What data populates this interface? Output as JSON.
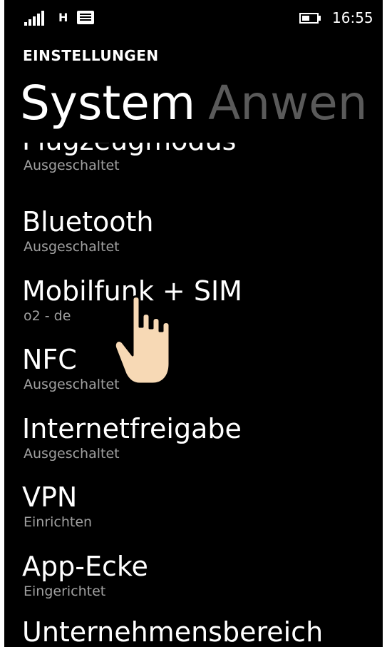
{
  "status_bar": {
    "network_type": "H",
    "time": "16:55",
    "battery_level_fraction": 0.45
  },
  "header": {
    "title": "EINSTELLUNGEN"
  },
  "pivot": {
    "active": "System",
    "next": "Anwen"
  },
  "settings": {
    "items": [
      {
        "title": "Flugzeugmodus",
        "subtitle": "Ausgeschaltet"
      },
      {
        "title": "Bluetooth",
        "subtitle": "Ausgeschaltet"
      },
      {
        "title": "Mobilfunk + SIM",
        "subtitle": "o2 - de"
      },
      {
        "title": "NFC",
        "subtitle": "Ausgeschaltet"
      },
      {
        "title": "Internetfreigabe",
        "subtitle": "Ausgeschaltet"
      },
      {
        "title": "VPN",
        "subtitle": "Einrichten"
      },
      {
        "title": "App-Ecke",
        "subtitle": "Eingerichtet"
      },
      {
        "title": "Unternehmensbereich",
        "subtitle": ""
      }
    ]
  },
  "colors": {
    "background": "#000000",
    "text": "#ffffff",
    "subtitle": "#a0a0a0",
    "pivot_inactive": "#5a5a5a",
    "hand_fill": "#f7d9b5"
  }
}
